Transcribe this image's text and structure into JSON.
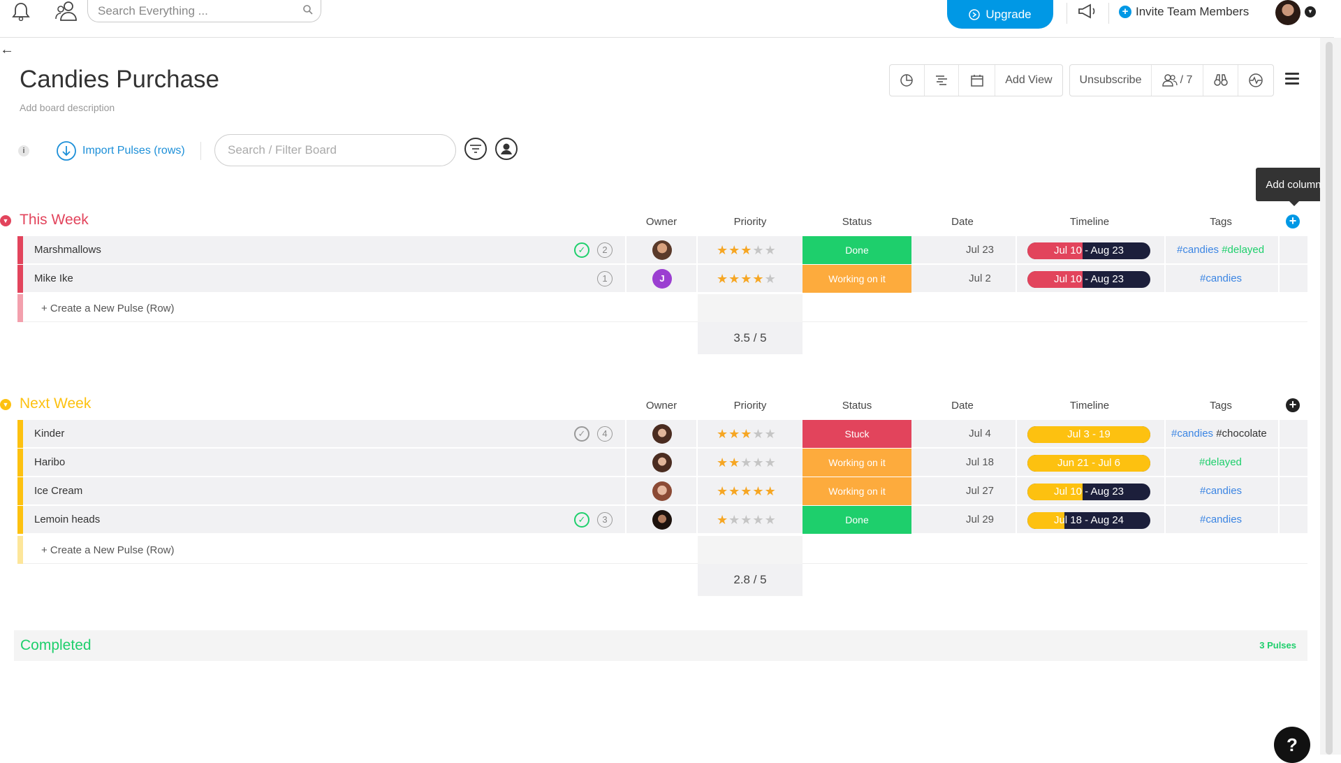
{
  "topbar": {
    "search_placeholder": "Search Everything ...",
    "upgrade_label": "Upgrade",
    "invite_label": "Invite Team Members"
  },
  "board": {
    "title": "Candies Purchase",
    "description": "Add board description"
  },
  "toolbar": {
    "add_view": "Add View",
    "unsubscribe": "Unsubscribe",
    "members_count": "/ 7"
  },
  "controls": {
    "info": "i",
    "import_label": "Import Pulses (rows)",
    "filter_placeholder": "Search / Filter Board"
  },
  "tooltip": "Add column",
  "columns": [
    "Owner",
    "Priority",
    "Status",
    "Date",
    "Timeline",
    "Tags"
  ],
  "colors": {
    "this_week": "#e2445c",
    "next_week": "#fdc110",
    "done": "#1ecf6c",
    "working": "#fdab3d",
    "stuck": "#e2445c",
    "timeline_dark": "#1c1f3b",
    "tag_blue": "#3b85e3",
    "tag_green": "#1ecf6c",
    "accent": "#0098e5"
  },
  "groups": [
    {
      "title": "This Week",
      "create_label": "+ Create a New Pulse (Row)",
      "summary": "3.5 / 5",
      "rows": [
        {
          "name": "Marshmallows",
          "check": "✓",
          "updates": "2",
          "owner_initial": "",
          "owner_icon": "avatar-man",
          "rating": 3,
          "status": "Done",
          "date": "Jul 23",
          "timeline": "Jul 10 - Aug 23",
          "timeline_progress": 0.45,
          "tags": [
            "#candies",
            "#delayed"
          ]
        },
        {
          "name": "Mike Ike",
          "check": "",
          "updates": "1",
          "owner_initial": "J",
          "owner_icon": "avatar-initial",
          "rating": 4,
          "status": "Working on it",
          "date": "Jul 2",
          "timeline": "Jul 10 - Aug 23",
          "timeline_progress": 0.45,
          "tags": [
            "#candies"
          ]
        }
      ]
    },
    {
      "title": "Next Week",
      "create_label": "+ Create a New Pulse (Row)",
      "summary": "2.8 / 5",
      "rows": [
        {
          "name": "Kinder",
          "check": "✓",
          "updates": "4",
          "owner_initial": "",
          "owner_icon": "avatar-woman",
          "rating": 3,
          "status": "Stuck",
          "date": "Jul 4",
          "timeline": "Jul 3 - 19",
          "timeline_progress": 1.0,
          "tags": [
            "#candies",
            "#chocolate"
          ]
        },
        {
          "name": "Haribo",
          "check": "",
          "updates": "",
          "owner_initial": "",
          "owner_icon": "avatar-woman",
          "rating": 2,
          "status": "Working on it",
          "date": "Jul 18",
          "timeline": "Jun 21 - Jul 6",
          "timeline_progress": 1.0,
          "tags": [
            "#delayed"
          ]
        },
        {
          "name": "Ice Cream",
          "check": "",
          "updates": "",
          "owner_initial": "",
          "owner_icon": "avatar-woman2",
          "rating": 5,
          "status": "Working on it",
          "date": "Jul 27",
          "timeline": "Jul 10 - Aug 23",
          "timeline_progress": 0.45,
          "tags": [
            "#candies"
          ]
        },
        {
          "name": "Lemoin heads",
          "check": "✓",
          "updates": "3",
          "owner_initial": "",
          "owner_icon": "avatar-woman3",
          "rating": 1,
          "status": "Done",
          "date": "Jul 29",
          "timeline": "Jul 18 - Aug 24",
          "timeline_progress": 0.3,
          "tags": [
            "#candies"
          ]
        }
      ]
    }
  ],
  "completed": {
    "title": "Completed",
    "count": "3 Pulses"
  },
  "help": "?"
}
